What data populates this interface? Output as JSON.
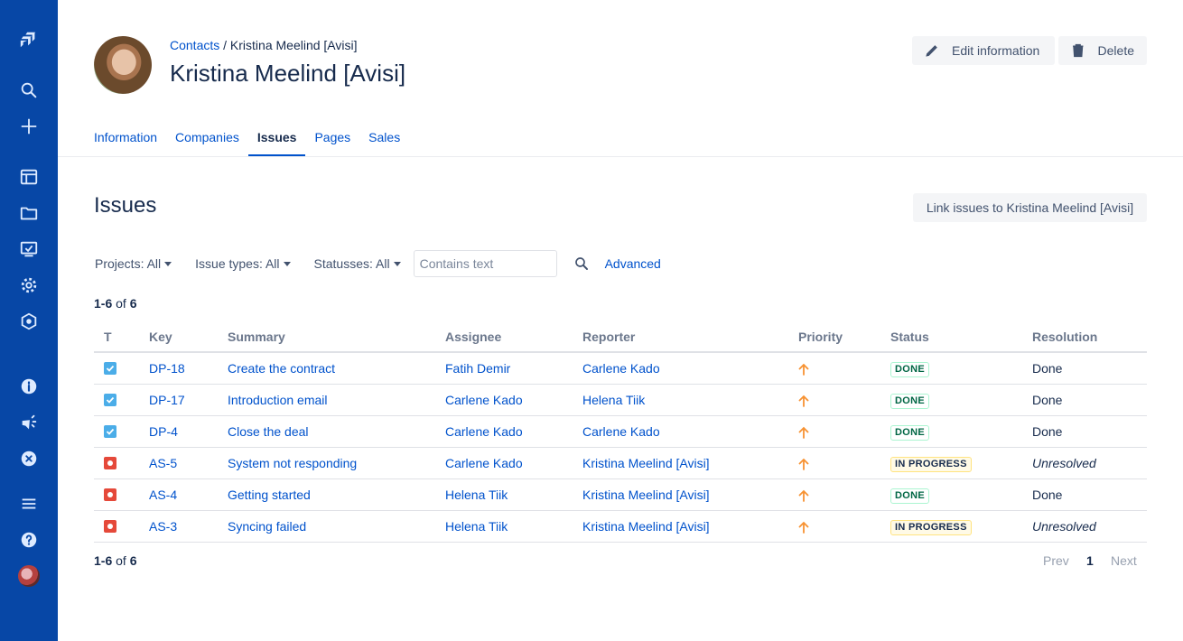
{
  "sidebar": {
    "items": [
      {
        "icon": "jira-logo-icon"
      },
      {
        "icon": "search-icon"
      },
      {
        "icon": "plus-icon"
      },
      {
        "icon": "board-icon"
      },
      {
        "icon": "folder-icon"
      },
      {
        "icon": "dashboard-icon"
      },
      {
        "icon": "gear-icon"
      },
      {
        "icon": "hexagon-icon"
      },
      {
        "icon": "info-icon"
      },
      {
        "icon": "megaphone-icon"
      },
      {
        "icon": "close-circle-icon"
      },
      {
        "icon": "menu-icon"
      },
      {
        "icon": "help-icon"
      }
    ]
  },
  "header": {
    "breadcrumb_link": "Contacts",
    "breadcrumb_sep": " / ",
    "breadcrumb_current": "Kristina Meelind [Avisi]",
    "title": "Kristina Meelind [Avisi]",
    "edit_label": "Edit information",
    "delete_label": "Delete"
  },
  "tabs": [
    {
      "label": "Information",
      "active": false
    },
    {
      "label": "Companies",
      "active": false
    },
    {
      "label": "Issues",
      "active": true
    },
    {
      "label": "Pages",
      "active": false
    },
    {
      "label": "Sales",
      "active": false
    }
  ],
  "issues": {
    "title": "Issues",
    "link_button": "Link issues to Kristina Meelind [Avisi]",
    "filters": {
      "projects": "Projects: All",
      "issue_types": "Issue types: All",
      "statuses": "Statusses: All",
      "search_placeholder": "Contains text",
      "advanced": "Advanced"
    },
    "count": {
      "range": "1-6",
      "of": "of",
      "total": "6"
    },
    "columns": {
      "t": "T",
      "key": "Key",
      "summary": "Summary",
      "assignee": "Assignee",
      "reporter": "Reporter",
      "priority": "Priority",
      "status": "Status",
      "resolution": "Resolution"
    },
    "rows": [
      {
        "type": "task",
        "key": "DP-18",
        "summary": "Create the contract",
        "assignee": "Fatih Demir",
        "reporter": "Carlene Kado",
        "status": "DONE",
        "resolution": "Done"
      },
      {
        "type": "task",
        "key": "DP-17",
        "summary": "Introduction email",
        "assignee": "Carlene Kado",
        "reporter": "Helena Tiik",
        "status": "DONE",
        "resolution": "Done"
      },
      {
        "type": "task",
        "key": "DP-4",
        "summary": "Close the deal",
        "assignee": "Carlene Kado",
        "reporter": "Carlene Kado",
        "status": "DONE",
        "resolution": "Done"
      },
      {
        "type": "bug",
        "key": "AS-5",
        "summary": "System not responding",
        "assignee": "Carlene Kado",
        "reporter": "Kristina Meelind [Avisi]",
        "status": "IN PROGRESS",
        "resolution": "Unresolved"
      },
      {
        "type": "bug",
        "key": "AS-4",
        "summary": "Getting started",
        "assignee": "Helena Tiik",
        "reporter": "Kristina Meelind [Avisi]",
        "status": "DONE",
        "resolution": "Done"
      },
      {
        "type": "bug",
        "key": "AS-3",
        "summary": "Syncing failed",
        "assignee": "Helena Tiik",
        "reporter": "Kristina Meelind [Avisi]",
        "status": "IN PROGRESS",
        "resolution": "Unresolved"
      }
    ],
    "pager": {
      "prev": "Prev",
      "current": "1",
      "next": "Next"
    }
  },
  "colors": {
    "sidebar": "#0747a6",
    "link": "#0052cc",
    "priority": "#f79232",
    "task": "#4bade8",
    "bug": "#e5493a"
  }
}
